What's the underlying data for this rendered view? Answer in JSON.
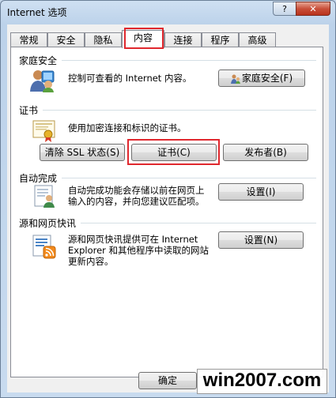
{
  "window": {
    "title": "Internet 选项",
    "help_label": "?",
    "close_label": "✕"
  },
  "tabs": [
    {
      "label": "常规"
    },
    {
      "label": "安全"
    },
    {
      "label": "隐私"
    },
    {
      "label": "内容",
      "selected": true
    },
    {
      "label": "连接"
    },
    {
      "label": "程序"
    },
    {
      "label": "高级"
    }
  ],
  "family_safety": {
    "title": "家庭安全",
    "description": "控制可查看的 Internet 内容。",
    "button": "家庭安全(F)",
    "icon": "family-safety-icon"
  },
  "certificates": {
    "title": "证书",
    "description": "使用加密连接和标识的证书。",
    "clear_ssl_button": "清除 SSL 状态(S)",
    "certificates_button": "证书(C)",
    "publishers_button": "发布者(B)",
    "icon": "certificate-icon"
  },
  "autocomplete": {
    "title": "自动完成",
    "description_line1": "自动完成功能会存储以前在网页上",
    "description_line2": "输入的内容，并向您建议匹配项。",
    "settings_button": "设置(I)",
    "icon": "autocomplete-icon"
  },
  "feeds": {
    "title": "源和网页快讯",
    "description_line1": "源和网页快讯提供可在 Internet",
    "description_line2": "Explorer 和其他程序中读取的网站",
    "description_line3": "更新内容。",
    "settings_button": "设置(N)",
    "icon": "rss-feed-icon"
  },
  "footer": {
    "ok_button": "确定",
    "watermark": "win2007.com"
  },
  "colors": {
    "highlight": "#e0282e",
    "titlebar": "#c4d6ea"
  }
}
